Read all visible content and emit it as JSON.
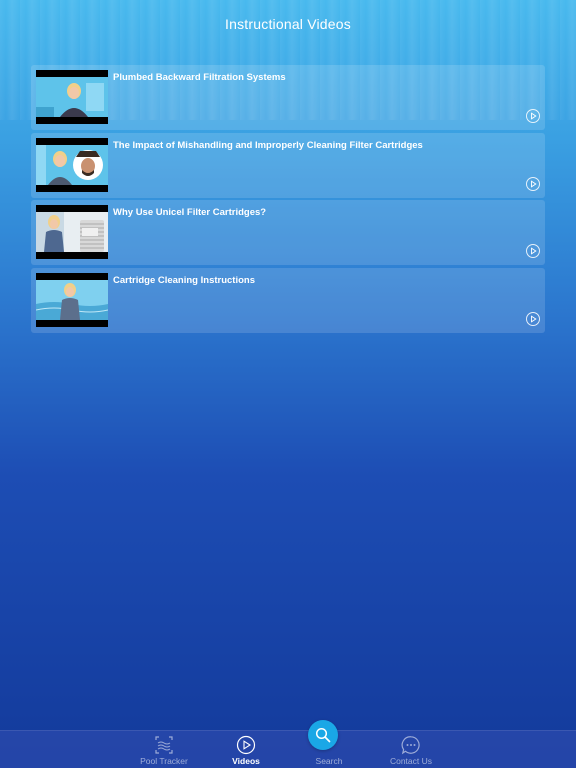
{
  "header": {
    "title": "Instructional Videos"
  },
  "videos": [
    {
      "title": "Plumbed Backward Filtration Systems"
    },
    {
      "title": "The Impact of Mishandling and Improperly Cleaning Filter Cartridges"
    },
    {
      "title": "Why Use Unicel Filter Cartridges?"
    },
    {
      "title": "Cartridge Cleaning Instructions"
    }
  ],
  "tabbar": {
    "tabs": [
      {
        "label": "Pool Tracker",
        "icon": "pool-tracker-icon",
        "active": false
      },
      {
        "label": "Videos",
        "icon": "play-circle-icon",
        "active": true
      },
      {
        "label": "Search",
        "icon": "search-icon",
        "active": false
      },
      {
        "label": "Contact Us",
        "icon": "chat-bubble-icon",
        "active": false
      }
    ]
  },
  "colors": {
    "accent": "#1aa7e6",
    "tabbar": "#2848aa"
  }
}
